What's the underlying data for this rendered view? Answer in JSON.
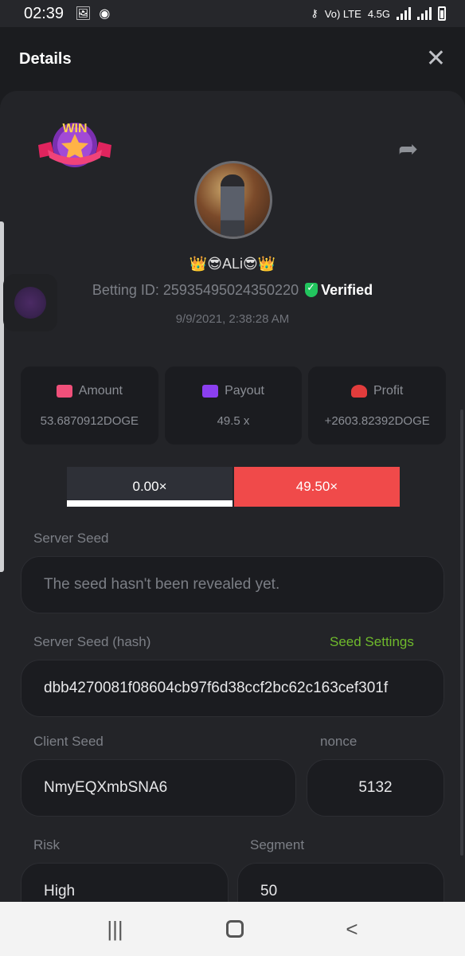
{
  "status_bar": {
    "time": "02:39",
    "network_text": "Vo) LTE",
    "network_speed": "4.5G"
  },
  "header": {
    "title": "Details"
  },
  "badge": {
    "text": "WIN"
  },
  "user": {
    "name": "👑😎ALi😎👑",
    "betting_id_label": "Betting ID: 25935495024350220",
    "verified_label": "Verified",
    "datetime": "9/9/2021, 2:38:28 AM"
  },
  "stats": [
    {
      "label": "Amount",
      "value": "53.6870912DOGE",
      "icon_color": "#f0507a"
    },
    {
      "label": "Payout",
      "value": "49.5 x",
      "icon_color": "#8b3ff0"
    },
    {
      "label": "Profit",
      "value": "+2603.82392DOGE",
      "icon_color": "#e23c3c"
    }
  ],
  "multipliers": {
    "left": "0.00×",
    "right": "49.50×"
  },
  "server_seed": {
    "label": "Server Seed",
    "value": "The seed hasn't been revealed yet."
  },
  "server_seed_hash": {
    "label": "Server Seed (hash)",
    "link": "Seed Settings",
    "value": "dbb4270081f08604cb97f6d38ccf2bc62c163cef301f"
  },
  "client_seed": {
    "label": "Client Seed",
    "value": "NmyEQXmbSNA6"
  },
  "nonce": {
    "label": "nonce",
    "value": "5132"
  },
  "risk": {
    "label": "Risk",
    "value": "High"
  },
  "segment": {
    "label": "Segment",
    "value": "50"
  },
  "colors": {
    "accent_green": "#6fba2c",
    "payout_red": "#f04a4a",
    "verified_green": "#22c55e"
  }
}
